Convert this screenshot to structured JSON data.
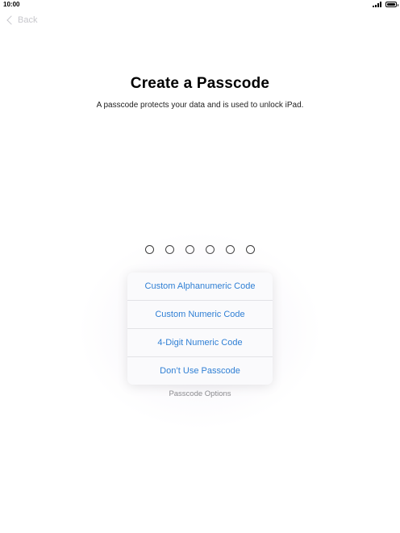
{
  "status_bar": {
    "time": "10:00",
    "signal_icon": "signal-bars-icon",
    "battery_icon": "battery-full-icon"
  },
  "nav": {
    "back_label": "Back",
    "back_icon": "chevron-left-icon"
  },
  "header": {
    "title": "Create a Passcode",
    "subtitle": "A passcode protects your data and is used to unlock iPad."
  },
  "passcode": {
    "digits": 6,
    "entered": 0
  },
  "options_menu": {
    "items": [
      {
        "label": "Custom Alphanumeric Code"
      },
      {
        "label": "Custom Numeric Code"
      },
      {
        "label": "4-Digit Numeric Code"
      },
      {
        "label": "Don’t Use Passcode"
      }
    ],
    "caption": "Passcode Options"
  },
  "colors": {
    "accent": "#2f7fd4",
    "back_disabled": "#c7c7cc",
    "caption": "#8a8a8e"
  }
}
